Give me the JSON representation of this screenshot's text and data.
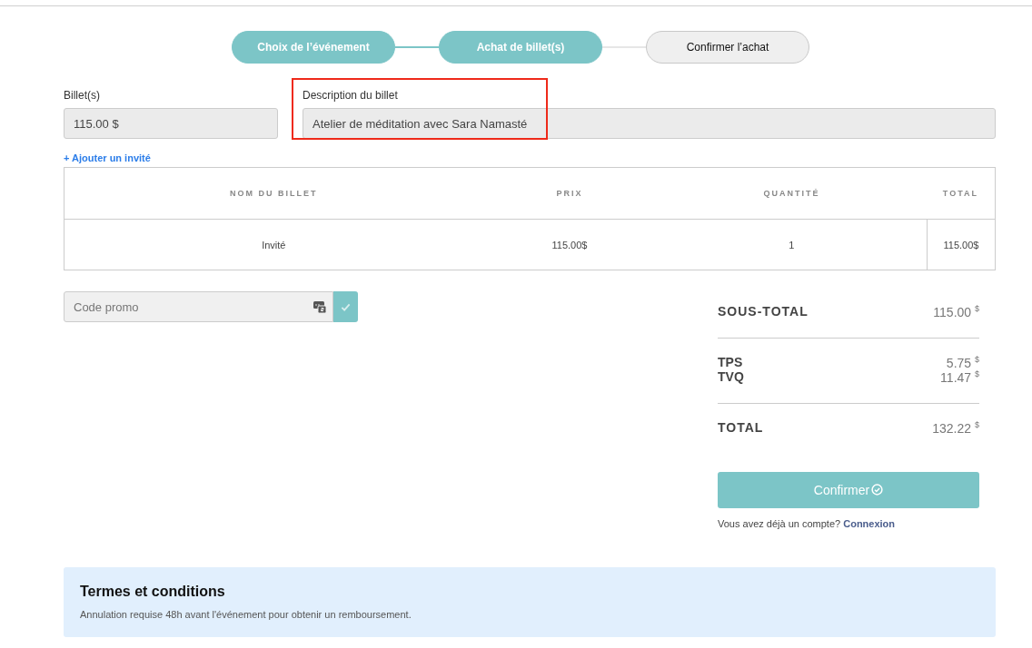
{
  "steps": [
    {
      "label": "Choix de l’événement",
      "completed": true
    },
    {
      "label": "Achat de billet(s)",
      "completed": true
    },
    {
      "label": "Confirmer l’achat",
      "completed": false
    }
  ],
  "fields": {
    "tickets": {
      "label": "Billet(s)",
      "value": "115.00 $"
    },
    "description": {
      "label": "Description du billet",
      "value": "Atelier de méditation avec Sara Namasté",
      "highlighted": true
    }
  },
  "add_guest_link": "+ Ajouter un invité",
  "table": {
    "columns": [
      "NOM DU BILLET",
      "PRIX",
      "QUANTITÉ",
      "TOTAL"
    ],
    "rows": [
      [
        "Invité",
        "115.00$",
        "1",
        "115.00$"
      ]
    ]
  },
  "promo": {
    "placeholder": "Code promo"
  },
  "summary": {
    "subtotal": {
      "label": "SOUS-TOTAL",
      "amount": "115.00",
      "currency": "$"
    },
    "taxes": [
      {
        "label": "TPS",
        "amount": "5.75",
        "currency": "$"
      },
      {
        "label": "TVQ",
        "amount": "11.47",
        "currency": "$"
      }
    ],
    "total": {
      "label": "TOTAL",
      "amount": "132.22",
      "currency": "$"
    }
  },
  "confirm_button": "Confirmer",
  "account_prompt": {
    "text": "Vous avez déjà un compte?",
    "link": "Connexion"
  },
  "terms": {
    "title": "Termes et conditions",
    "text": "Annulation requise 48h avant l'événement pour obtenir un remboursement."
  }
}
